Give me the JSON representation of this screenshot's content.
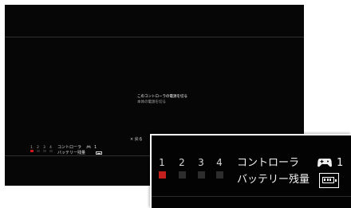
{
  "menu": {
    "turn_off_controller": "このコントローラの電源を切る",
    "turn_off_system": "本体の電源を切る"
  },
  "controller_status": {
    "ports": [
      {
        "number": "1",
        "active": true
      },
      {
        "number": "2",
        "active": false
      },
      {
        "number": "3",
        "active": false
      },
      {
        "number": "4",
        "active": false
      }
    ],
    "controller_label": "コントローラ",
    "controller_number": "1",
    "battery_label": "バッテリー残量",
    "battery_icon": "battery-icon",
    "gamepad_icon": "gamepad-icon"
  },
  "footer": {
    "back_hint": "× 戻る"
  },
  "colors": {
    "active_port": "#c41f1f",
    "background": "#060606"
  }
}
